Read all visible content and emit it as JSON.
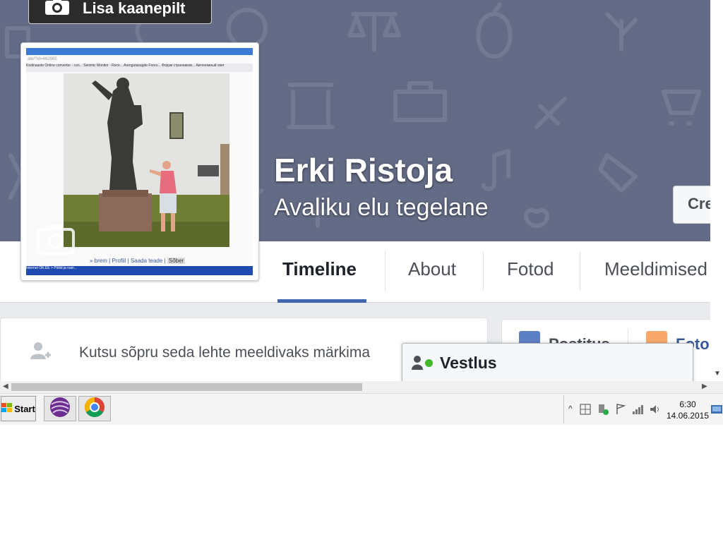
{
  "cover": {
    "add_cover_label": "Lisa kaanepilt"
  },
  "profile": {
    "name": "Erki Ristoja",
    "category": "Avaliku elu tegelane",
    "create_button": "Cre"
  },
  "profile_photo": {
    "url_text": "ate/?id=462965",
    "tabs_text": "Kodinaaste   Online converter - con...   Seismic Monitor - Rece...   Arengutasagde Fooru...   Форум странников...   Автономный свет",
    "links_text": "» brem | Profiil | Saada teade |",
    "links_btn": "Sõber",
    "taskbar_text": "Internet      OK.EE > Pildid ja nain..."
  },
  "tabs": [
    {
      "label": "Timeline",
      "active": true
    },
    {
      "label": "About",
      "active": false
    },
    {
      "label": "Fotod",
      "active": false
    },
    {
      "label": "Meeldimised",
      "active": false
    }
  ],
  "invite": {
    "text": "Kutsu sõpru seda lehte meeldivaks märkima"
  },
  "composer": {
    "post_label": "Postitus",
    "photo_label": "Foto"
  },
  "chat": {
    "label": "Vestlus",
    "status_color": "#42b72a"
  },
  "taskbar": {
    "start_label": "Start",
    "time": "6:30",
    "date": "14.06.2015"
  },
  "colors": {
    "cover_bg": "#636b86",
    "accent": "#4267b2",
    "page_bg": "#e9ebee"
  }
}
